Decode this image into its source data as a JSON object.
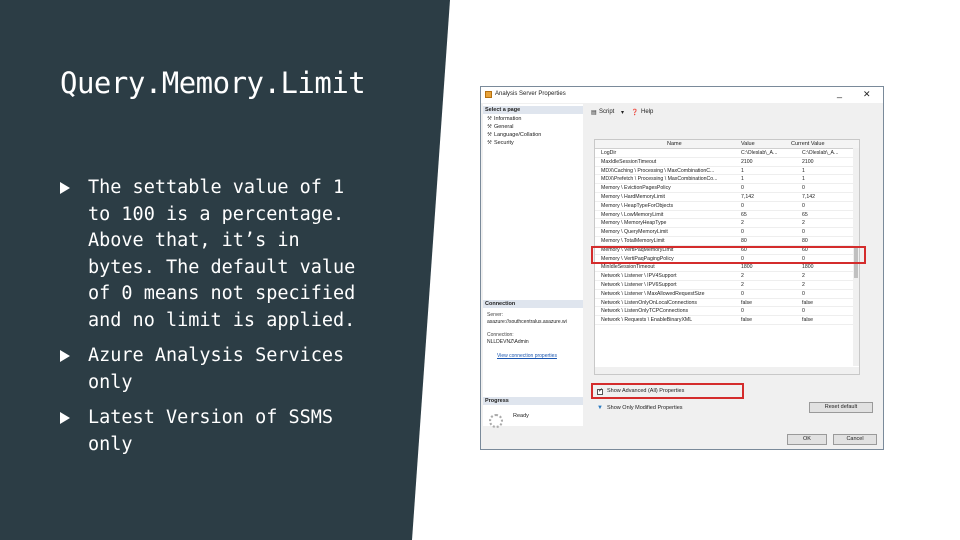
{
  "slide": {
    "title": "Query.Memory.Limit",
    "bullets": [
      "The settable value of 1 to 100 is a percentage. Above that, it’s in bytes. The default value of 0 means not specified and no limit is applied.",
      "Azure Analysis Services only",
      "Latest Version of SSMS only"
    ],
    "colors": {
      "panel": "#2c3d45",
      "highlight": "#d42c2c"
    }
  },
  "dialog": {
    "title": "Analysis Server Properties",
    "window_controls": {
      "minimize": "_",
      "close": "✕"
    },
    "select_page_header": "Select a page",
    "pages": [
      "Information",
      "General",
      "Language/Collation",
      "Security"
    ],
    "connection_header": "Connection",
    "server_label": "Server:",
    "server_value": "asazure://southcentralus.asazure.wi",
    "connection_label": "Connection:",
    "connection_value": "NLLDEVNZ\\Admin",
    "connection_link": "View connection properties",
    "progress_header": "Progress",
    "progress_status": "Ready",
    "toolbar": {
      "script": "Script",
      "help": "Help"
    },
    "columns": [
      "Name",
      "Value",
      "Current Value"
    ],
    "rows": [
      {
        "name": "LogDir",
        "value": "C:\\Oleslab\\_A...",
        "current": "C:\\Oleslab\\_A..."
      },
      {
        "name": "MaxIdleSessionTimeout",
        "value": "2100",
        "current": "2100"
      },
      {
        "name": "MDX\\Caching \\ Processing \\ MaxCombinationC...",
        "value": "1",
        "current": "1"
      },
      {
        "name": "MDX\\Prefetch \\ Processing \\ MaxCombinationCo...",
        "value": "1",
        "current": "1"
      },
      {
        "name": "Memory \\ EvictionPagesPolicy",
        "value": "0",
        "current": "0"
      },
      {
        "name": "Memory \\ HardMemoryLimit",
        "value": "7,142",
        "current": "7,142"
      },
      {
        "name": "Memory \\ HeapTypeForObjects",
        "value": "0",
        "current": "0"
      },
      {
        "name": "Memory \\ LowMemoryLimit",
        "value": "65",
        "current": "65"
      },
      {
        "name": "Memory \\ MemoryHeapType",
        "value": "2",
        "current": "2"
      },
      {
        "name": "Memory \\ QueryMemoryLimit",
        "value": "0",
        "current": "0"
      },
      {
        "name": "Memory \\ TotalMemoryLimit",
        "value": "80",
        "current": "80"
      },
      {
        "name": "Memory \\ VertiPaqMemoryLimit",
        "value": "60",
        "current": "60"
      },
      {
        "name": "Memory \\ VertiPaqPagingPolicy",
        "value": "0",
        "current": "0"
      },
      {
        "name": "MinIdleSessionTimeout",
        "value": "1800",
        "current": "1800"
      },
      {
        "name": "Network \\ Listener \\ IPV4Support",
        "value": "2",
        "current": "2"
      },
      {
        "name": "Network \\ Listener \\ IPV6Support",
        "value": "2",
        "current": "2"
      },
      {
        "name": "Network \\ Listener \\ MaxAllowedRequestSize",
        "value": "0",
        "current": "0"
      },
      {
        "name": "Network \\ ListenOnlyOnLocalConnections",
        "value": "false",
        "current": "false"
      },
      {
        "name": "Network \\ ListenOnlyTCPConnections",
        "value": "0",
        "current": "0"
      },
      {
        "name": "Network \\ Requests \\ EnableBinaryXML",
        "value": "false",
        "current": "false"
      }
    ],
    "show_advanced_label": "Show Advanced (All) Properties",
    "show_modified_label": "Show Only Modified Properties",
    "reset_default_label": "Reset default",
    "ok_label": "OK",
    "cancel_label": "Cancel"
  }
}
